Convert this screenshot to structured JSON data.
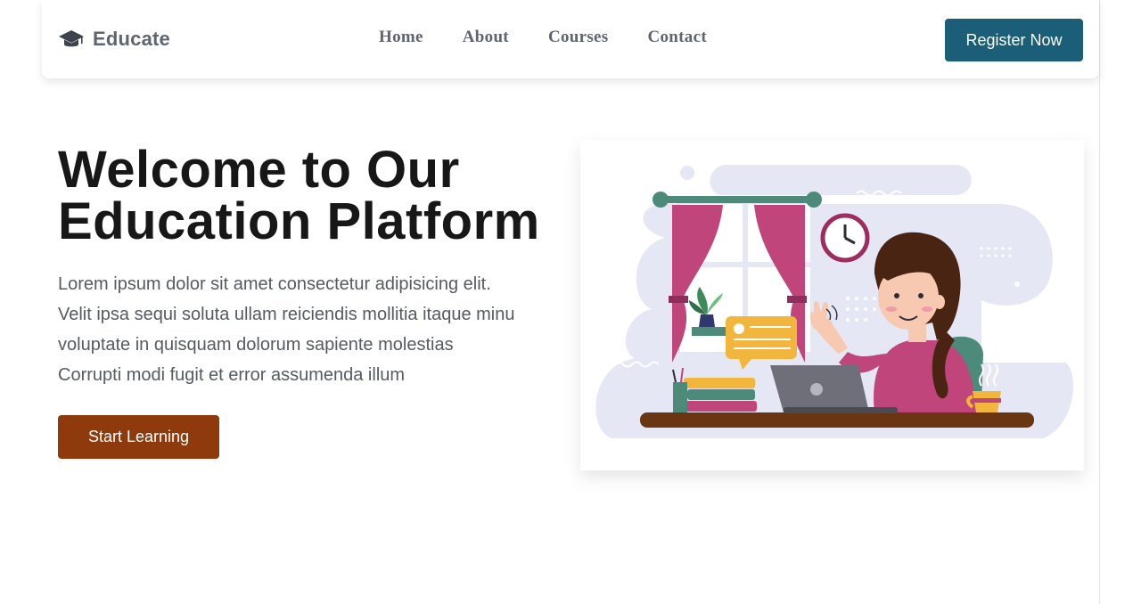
{
  "navbar": {
    "brand": {
      "name": "Educate",
      "icon": "graduation-cap-icon"
    },
    "links": [
      "Home",
      "About",
      "Courses",
      "Contact"
    ],
    "register_label": "Register Now"
  },
  "hero": {
    "title_line1": "Welcome to Our",
    "title_line2": "Education Platform",
    "description_lines": [
      "Lorem ipsum dolor sit amet consectetur adipisicing elit.",
      "Velit ipsa sequi soluta ullam reiciendis mollitia itaque minu",
      "voluptate in quisquam dolorum sapiente molestias",
      "Corrupti modi fugit et error assumenda illum"
    ],
    "cta_label": "Start Learning"
  },
  "colors": {
    "primary": "#1b5e78",
    "cta": "#8f3a0c",
    "text_dark": "#171717",
    "text_muted": "#555b63"
  }
}
